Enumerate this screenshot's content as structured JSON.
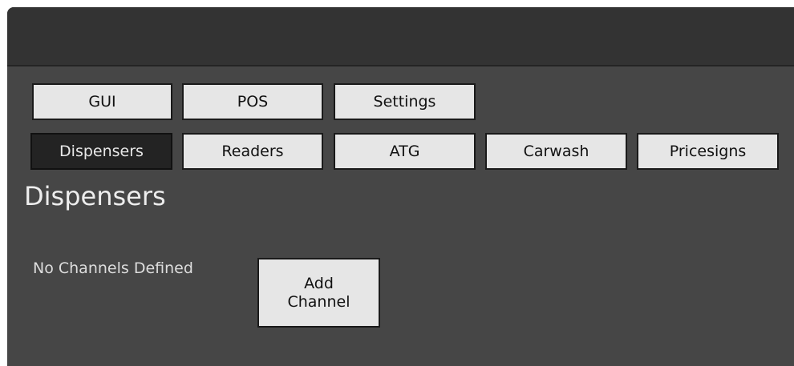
{
  "top_tabs": {
    "gui": "GUI",
    "pos": "POS",
    "settings": "Settings"
  },
  "sub_tabs": {
    "dispensers": "Dispensers",
    "readers": "Readers",
    "atg": "ATG",
    "carwash": "Carwash",
    "pricesigns": "Pricesigns"
  },
  "content": {
    "title": "Dispensers",
    "empty_message": "No Channels Defined",
    "add_channel_label": "Add Channel"
  },
  "colors": {
    "window_bg": "#464646",
    "titlebar_bg": "#333333",
    "tab_bg": "#e6e6e6",
    "active_tab_bg": "#232323"
  }
}
